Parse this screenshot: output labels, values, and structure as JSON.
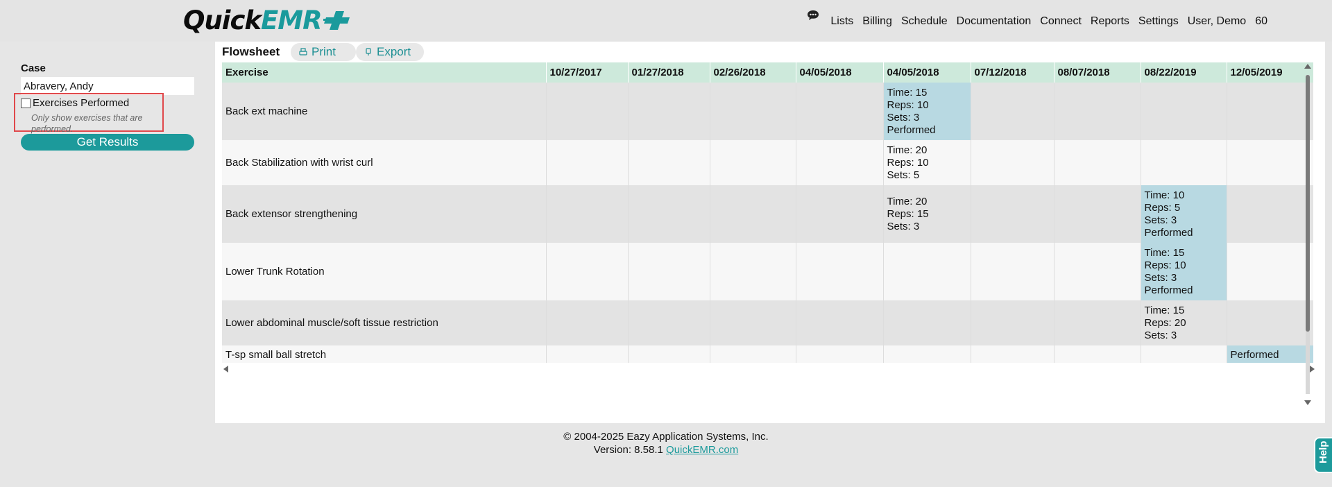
{
  "brand": {
    "logo_part1": "Quick",
    "logo_part2": "EMR",
    "accent_color": "#1c9a9b"
  },
  "header": {
    "chat_icon": "chat-bubble-icon",
    "nav": [
      "Lists",
      "Billing",
      "Schedule",
      "Documentation",
      "Connect",
      "Reports",
      "Settings",
      "User, Demo",
      "60"
    ]
  },
  "sidebar": {
    "case_label": "Case",
    "case_value": "Abravery, Andy",
    "checkbox_label": "Exercises Performed",
    "checkbox_checked": false,
    "hint": "Only show exercises that are performed.",
    "get_results": "Get Results"
  },
  "flowsheet": {
    "title": "Flowsheet",
    "print_label": "Print",
    "export_label": "Export",
    "columns": [
      "Exercise",
      "10/27/2017",
      "01/27/2018",
      "02/26/2018",
      "04/05/2018",
      "04/05/2018",
      "07/12/2018",
      "08/07/2018",
      "08/22/2019",
      "12/05/2019"
    ],
    "rows": [
      {
        "name": "Back ext machine",
        "cells": [
          "",
          "",
          "",
          "",
          "Time: 15|Reps: 10|Sets: 3|Performed",
          "",
          "",
          "",
          ""
        ]
      },
      {
        "name": "Back Stabilization with wrist curl",
        "cells": [
          "",
          "",
          "",
          "",
          "Time: 20|Reps: 10|Sets: 5",
          "",
          "",
          "",
          ""
        ]
      },
      {
        "name": "Back extensor strengthening",
        "cells": [
          "",
          "",
          "",
          "",
          "Time: 20|Reps: 15|Sets: 3",
          "",
          "",
          "Time: 10|Reps: 5|Sets: 3|Performed",
          ""
        ]
      },
      {
        "name": "Lower Trunk Rotation",
        "cells": [
          "",
          "",
          "",
          "",
          "",
          "",
          "",
          "Time: 15|Reps: 10|Sets: 3|Performed",
          ""
        ]
      },
      {
        "name": "Lower abdominal muscle/soft tissue restriction",
        "cells": [
          "",
          "",
          "",
          "",
          "",
          "",
          "",
          "Time: 15|Reps: 20|Sets: 3",
          ""
        ]
      },
      {
        "name": "T-sp small ball stretch",
        "cells": [
          "",
          "",
          "",
          "",
          "",
          "",
          "",
          "",
          "Performed"
        ]
      }
    ]
  },
  "footer": {
    "copyright": "© 2004-2025 Eazy Application Systems, Inc.",
    "version_prefix": "Version: 8.58.1",
    "link_text": "QuickEMR.com"
  },
  "help": {
    "label": "Help"
  }
}
